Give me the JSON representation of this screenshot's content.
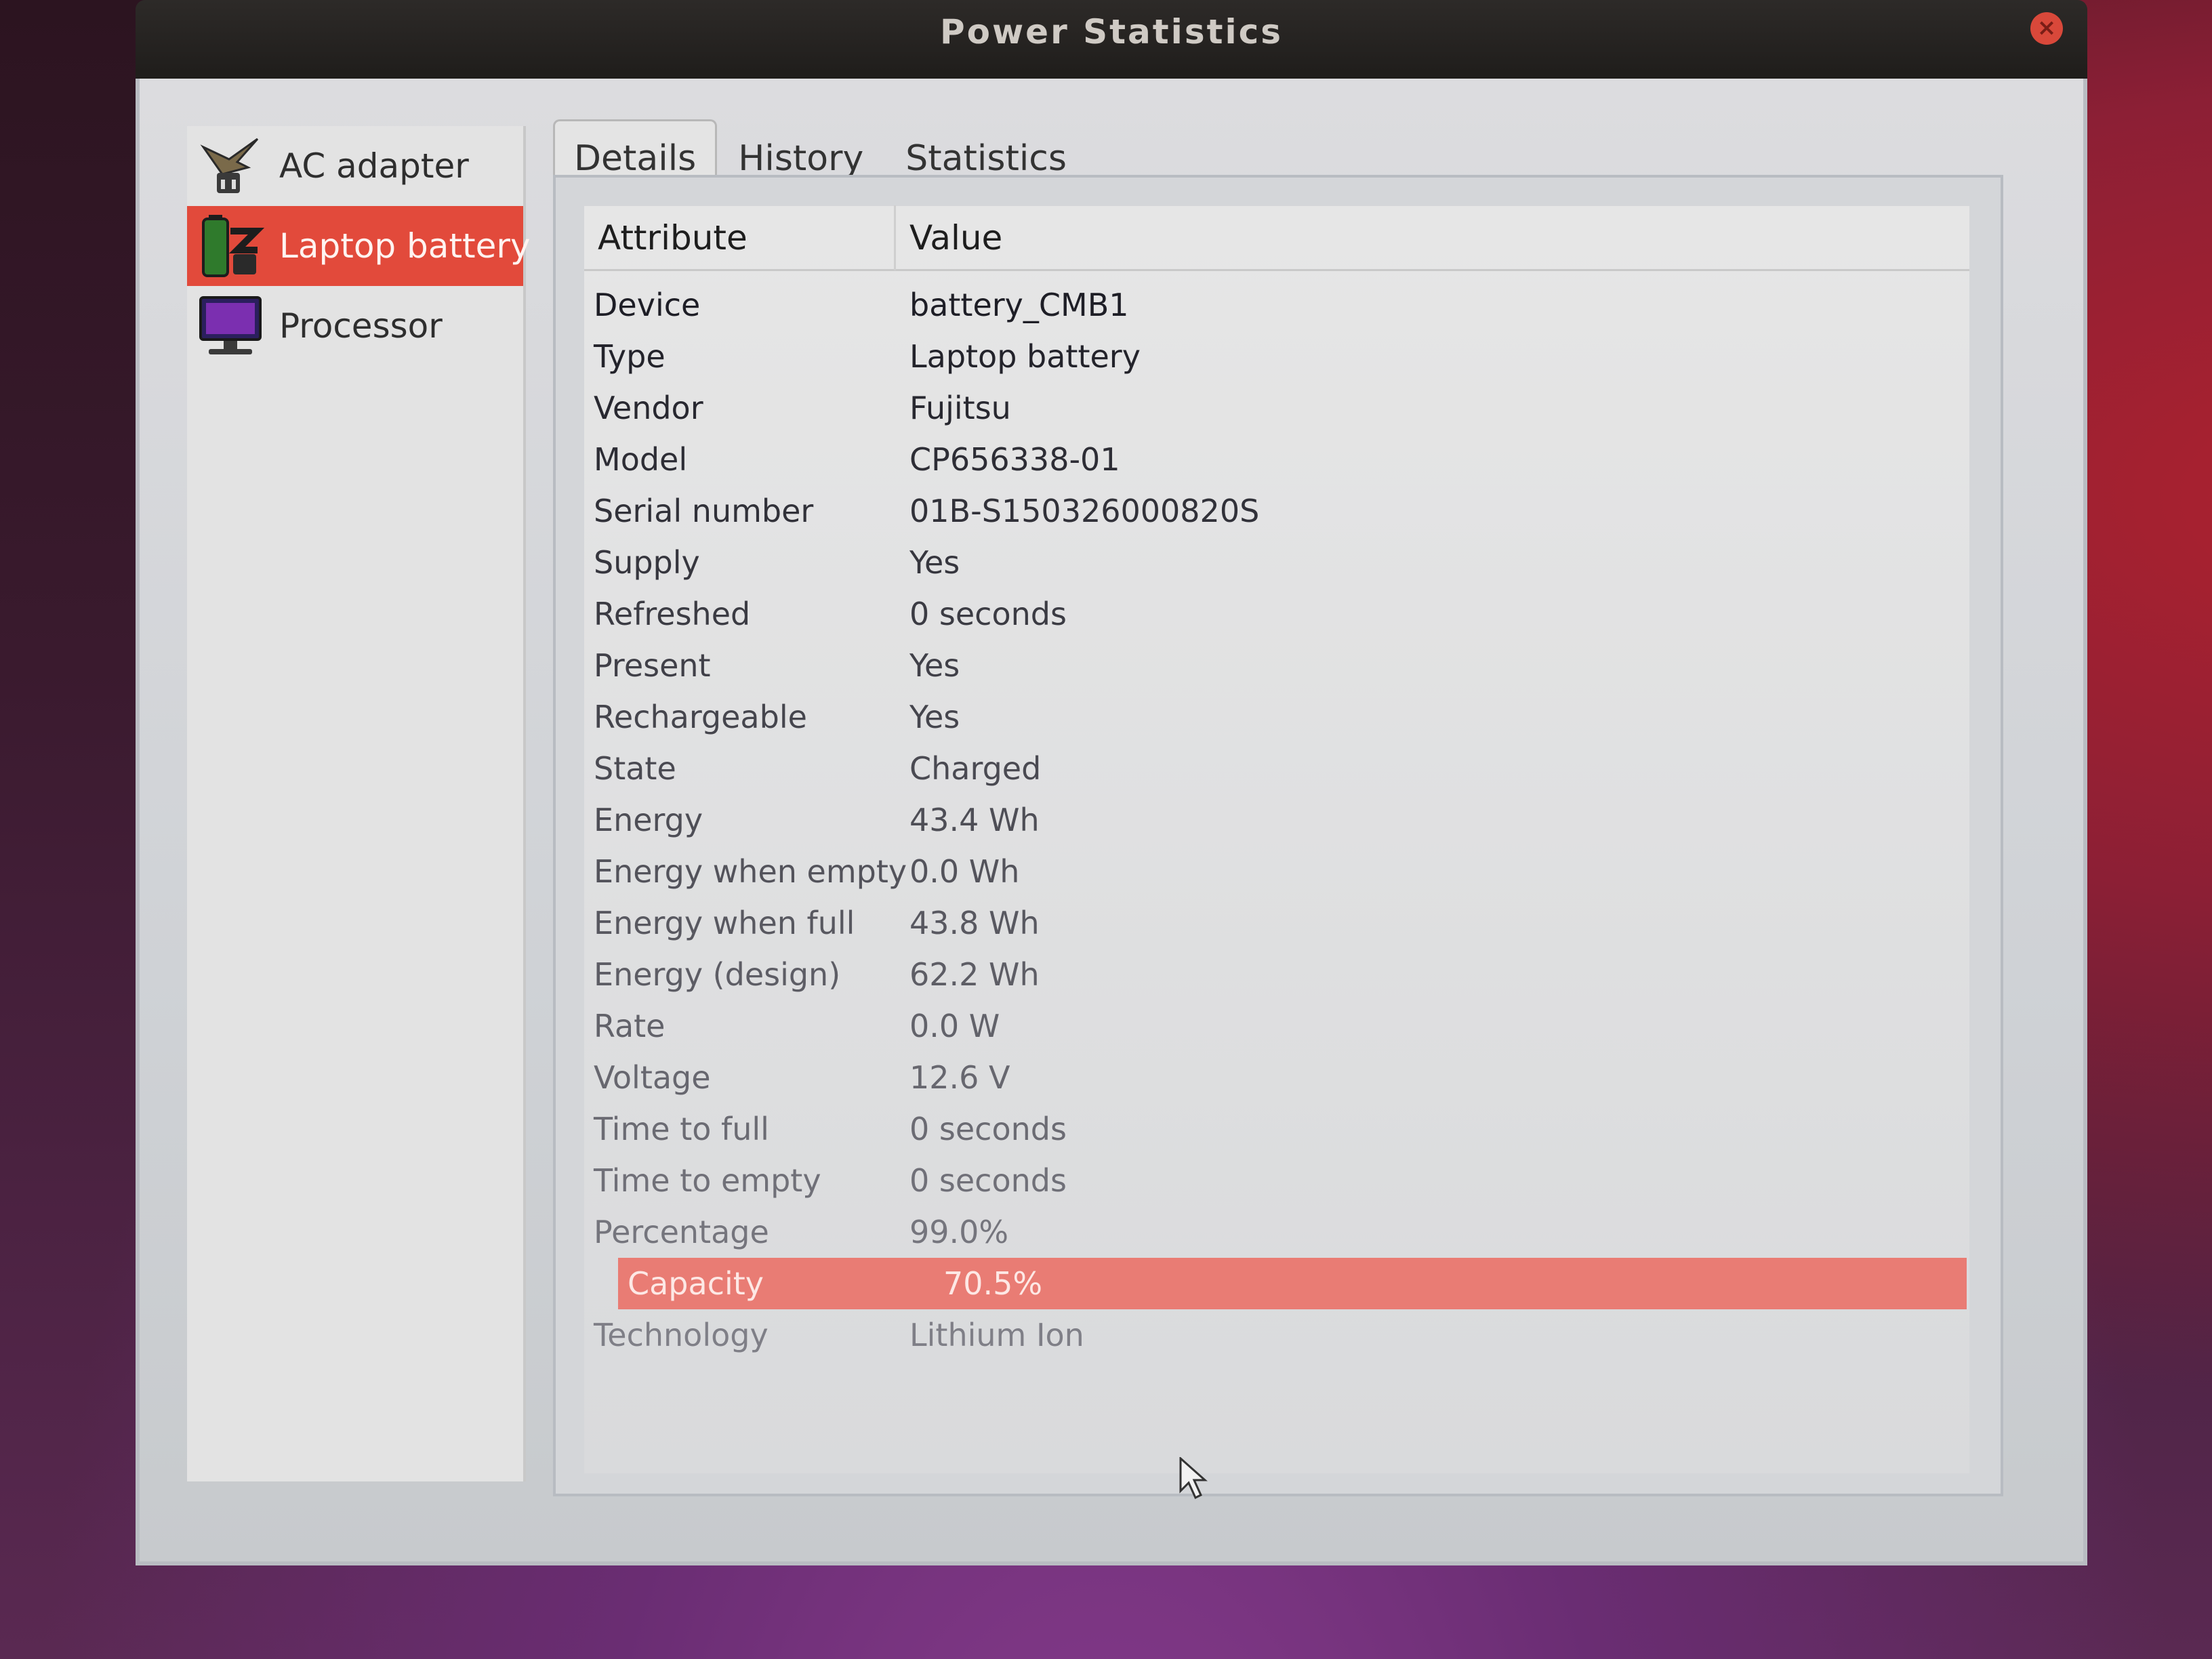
{
  "window": {
    "title": "Power Statistics",
    "close_icon": "close-icon"
  },
  "sidebar": {
    "items": [
      {
        "label": "AC adapter",
        "icon": "ac-adapter-icon",
        "active": false
      },
      {
        "label": "Laptop battery",
        "icon": "battery-icon",
        "active": true
      },
      {
        "label": "Processor",
        "icon": "monitor-icon",
        "active": false
      }
    ]
  },
  "tabs": [
    {
      "label": "Details",
      "active": true
    },
    {
      "label": "History",
      "active": false
    },
    {
      "label": "Statistics",
      "active": false
    }
  ],
  "table": {
    "headers": {
      "attribute": "Attribute",
      "value": "Value"
    },
    "rows": [
      {
        "attribute": "Device",
        "value": "battery_CMB1"
      },
      {
        "attribute": "Type",
        "value": "Laptop battery"
      },
      {
        "attribute": "Vendor",
        "value": "Fujitsu"
      },
      {
        "attribute": "Model",
        "value": "CP656338-01"
      },
      {
        "attribute": "Serial number",
        "value": "01B-S150326000820S"
      },
      {
        "attribute": "Supply",
        "value": "Yes"
      },
      {
        "attribute": "Refreshed",
        "value": "0 seconds"
      },
      {
        "attribute": "Present",
        "value": "Yes"
      },
      {
        "attribute": "Rechargeable",
        "value": "Yes"
      },
      {
        "attribute": "State",
        "value": "Charged"
      },
      {
        "attribute": "Energy",
        "value": "43.4 Wh"
      },
      {
        "attribute": "Energy when empty",
        "value": "0.0 Wh"
      },
      {
        "attribute": "Energy when full",
        "value": "43.8 Wh"
      },
      {
        "attribute": "Energy (design)",
        "value": "62.2 Wh"
      },
      {
        "attribute": "Rate",
        "value": "0.0 W"
      },
      {
        "attribute": "Voltage",
        "value": "12.6 V"
      },
      {
        "attribute": "Time to full",
        "value": "0 seconds"
      },
      {
        "attribute": "Time to empty",
        "value": "0 seconds"
      },
      {
        "attribute": "Percentage",
        "value": "99.0%"
      },
      {
        "attribute": "Capacity",
        "value": "70.5%",
        "selected": true
      },
      {
        "attribute": "Technology",
        "value": "Lithium Ion"
      }
    ]
  },
  "colors": {
    "accent": "#e24a3b",
    "selected_row": "#e97c74"
  }
}
